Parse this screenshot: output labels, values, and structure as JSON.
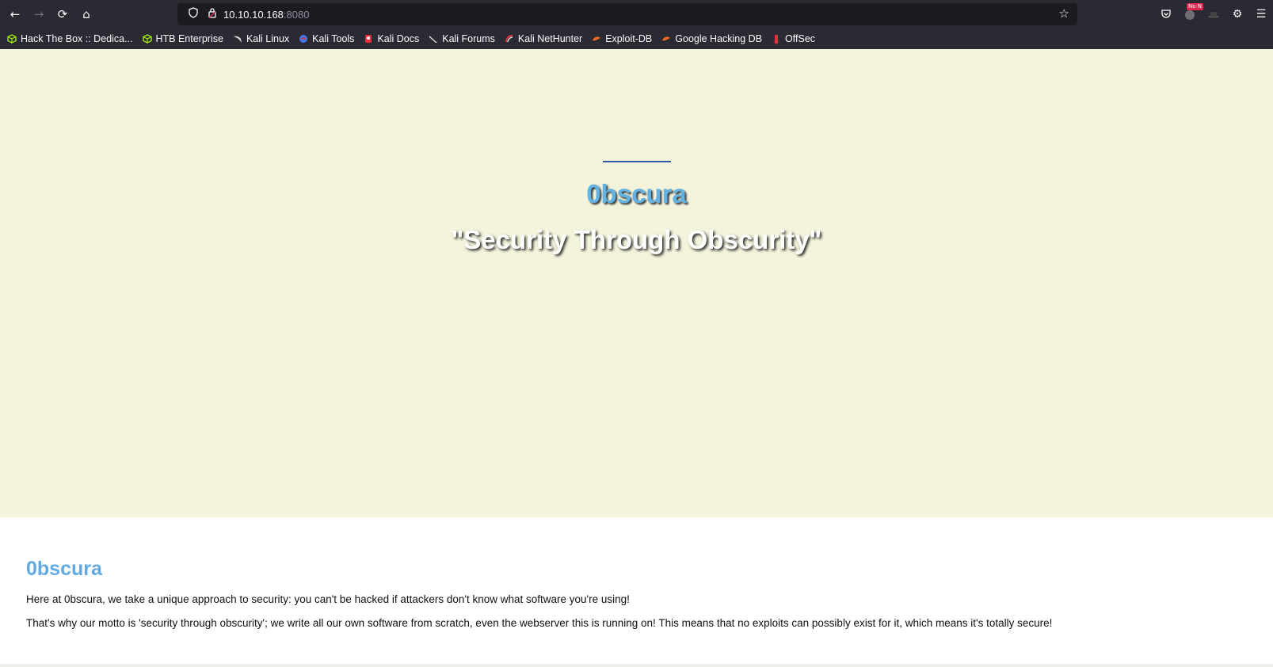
{
  "browser": {
    "url_host": "10.10.10.168",
    "url_port": ":8080",
    "bookmarks": [
      {
        "label": "Hack The Box :: Dedica...",
        "icon": "htb-cube-icon",
        "color": "#9fef00"
      },
      {
        "label": "HTB Enterprise",
        "icon": "htb-cube-icon",
        "color": "#9fef00"
      },
      {
        "label": "Kali Linux",
        "icon": "kali-dragon-icon",
        "color": "#e0e0e0"
      },
      {
        "label": "Kali Tools",
        "icon": "kali-tools-icon",
        "color": "#367bf0"
      },
      {
        "label": "Kali Docs",
        "icon": "kali-docs-icon",
        "color": "#e0303a"
      },
      {
        "label": "Kali Forums",
        "icon": "kali-dragon-icon",
        "color": "#e0e0e0"
      },
      {
        "label": "Kali NetHunter",
        "icon": "nethunter-icon",
        "color": "#e0303a"
      },
      {
        "label": "Exploit-DB",
        "icon": "exploitdb-icon",
        "color": "#f06b1d"
      },
      {
        "label": "Google Hacking DB",
        "icon": "exploitdb-icon",
        "color": "#f06b1d"
      },
      {
        "label": "OffSec",
        "icon": "offsec-icon",
        "color": "#e0303a"
      }
    ],
    "badge_text": "No N"
  },
  "hero": {
    "title": "0bscura",
    "motto": "\"Security Through Obscurity\""
  },
  "content": {
    "title": "0bscura",
    "paragraph1": "Here at 0bscura, we take a unique approach to security: you can't be hacked if attackers don't know what software you're using!",
    "paragraph2": "That's why our motto is 'security through obscurity'; we write all our own software from scratch, even the webserver this is running on! This means that no exploits can possibly exist for it, which means it's totally secure!"
  },
  "colors": {
    "hero_bg": "#f4f4dc",
    "title_blue": "#62b3e4",
    "rule_blue": "#2e5aa8",
    "chrome_bg": "#2b2a33"
  }
}
